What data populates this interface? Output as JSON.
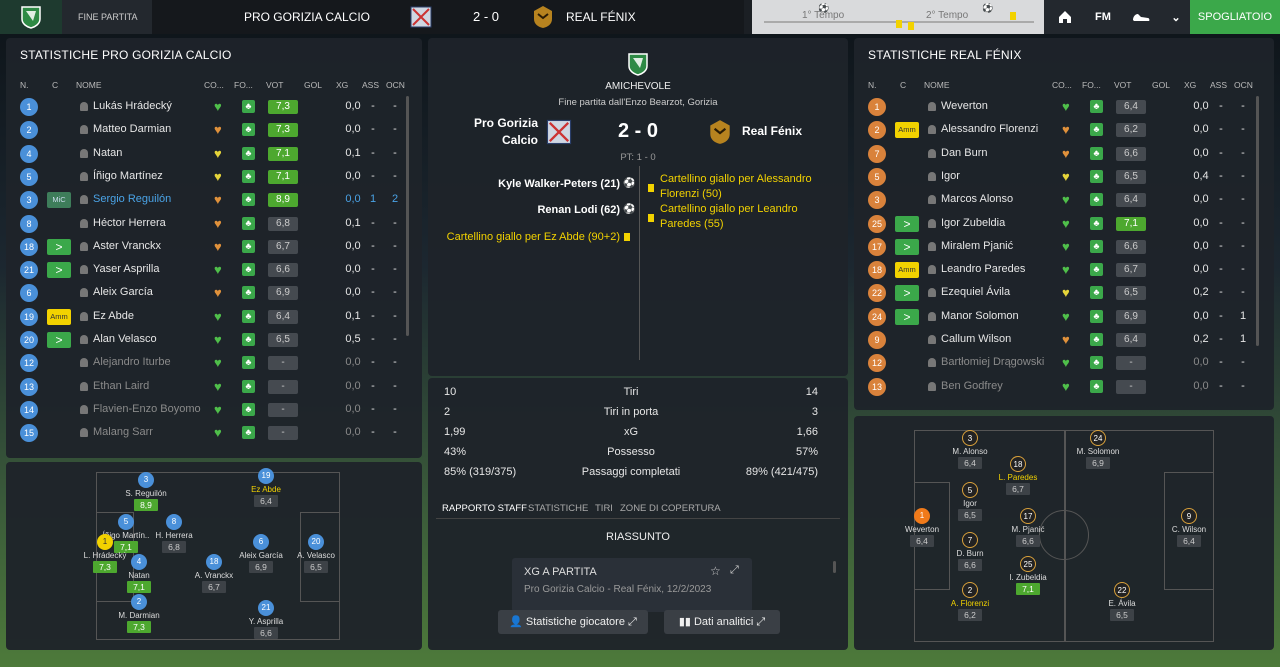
{
  "topbar": {
    "status": "FINE PARTITA",
    "home": "PRO GORIZIA CALCIO",
    "score": "2 - 0",
    "away": "REAL FÉNIX",
    "t1": "1° Tempo",
    "t2": "2° Tempo",
    "fm": "FM",
    "spogliatoio": "SPOGLIATOIO"
  },
  "home_panel": {
    "title": "STATISTICHE PRO GORIZIA CALCIO",
    "headers": {
      "n": "N.",
      "c": "C",
      "nome": "NOME",
      "con": "CO...",
      "form": "FO...",
      "vot": "VOT",
      "gol": "GOL",
      "xg": "XG",
      "ass": "ASS",
      "ocn": "OCN"
    },
    "players": [
      {
        "n": "1",
        "c": "",
        "name": "Lukás Hrádecký",
        "heart": "g",
        "vot": "7,3",
        "vg": true,
        "xg": "0,0",
        "ass": "-",
        "ocn": "-"
      },
      {
        "n": "2",
        "c": "",
        "name": "Matteo Darmian",
        "heart": "o",
        "vot": "7,3",
        "vg": true,
        "xg": "0,0",
        "ass": "-",
        "ocn": "-"
      },
      {
        "n": "4",
        "c": "",
        "name": "Natan",
        "heart": "y",
        "vot": "7,1",
        "vg": true,
        "xg": "0,1",
        "ass": "-",
        "ocn": "-"
      },
      {
        "n": "5",
        "c": "",
        "name": "Íñigo Martínez",
        "heart": "y",
        "vot": "7,1",
        "vg": true,
        "xg": "0,0",
        "ass": "-",
        "ocn": "-"
      },
      {
        "n": "3",
        "c": "MiC",
        "name": "Sergio Reguilón",
        "heart": "o",
        "vot": "8,9",
        "vg": true,
        "xg": "0,0",
        "ass": "1",
        "ocn": "2",
        "hl": true
      },
      {
        "n": "8",
        "c": "",
        "name": "Héctor Herrera",
        "heart": "o",
        "vot": "6,8",
        "vg": false,
        "xg": "0,1",
        "ass": "-",
        "ocn": "-"
      },
      {
        "n": "18",
        "c": "arrow",
        "name": "Aster Vranckx",
        "heart": "o",
        "vot": "6,7",
        "vg": false,
        "xg": "0,0",
        "ass": "-",
        "ocn": "-"
      },
      {
        "n": "21",
        "c": "arrow",
        "name": "Yaser Asprilla",
        "heart": "g",
        "vot": "6,6",
        "vg": false,
        "xg": "0,0",
        "ass": "-",
        "ocn": "-"
      },
      {
        "n": "6",
        "c": "",
        "name": "Aleix García",
        "heart": "o",
        "vot": "6,9",
        "vg": false,
        "xg": "0,0",
        "ass": "-",
        "ocn": "-"
      },
      {
        "n": "19",
        "c": "Amm",
        "name": "Ez Abde",
        "heart": "g",
        "vot": "6,4",
        "vg": false,
        "xg": "0,1",
        "ass": "-",
        "ocn": "-"
      },
      {
        "n": "20",
        "c": "arrow",
        "name": "Alan Velasco",
        "heart": "g",
        "vot": "6,5",
        "vg": false,
        "xg": "0,5",
        "ass": "-",
        "ocn": "-"
      },
      {
        "n": "12",
        "c": "",
        "name": "Alejandro Iturbe",
        "heart": "g",
        "vot": "-",
        "vg": false,
        "xg": "0,0",
        "ass": "-",
        "ocn": "-",
        "dim": true
      },
      {
        "n": "13",
        "c": "",
        "name": "Ethan Laird",
        "heart": "g",
        "vot": "-",
        "vg": false,
        "xg": "0,0",
        "ass": "-",
        "ocn": "-",
        "dim": true
      },
      {
        "n": "14",
        "c": "",
        "name": "Flavien-Enzo Boyomo",
        "heart": "g",
        "vot": "-",
        "vg": false,
        "xg": "0,0",
        "ass": "-",
        "ocn": "-",
        "dim": true
      },
      {
        "n": "15",
        "c": "",
        "name": "Malang Sarr",
        "heart": "g",
        "vot": "-",
        "vg": false,
        "xg": "0,0",
        "ass": "-",
        "ocn": "-",
        "dim": true
      }
    ]
  },
  "away_panel": {
    "title": "STATISTICHE REAL FÉNIX",
    "players": [
      {
        "n": "1",
        "c": "",
        "name": "Weverton",
        "heart": "g",
        "vot": "6,4",
        "vg": false,
        "xg": "0,0",
        "ass": "-",
        "ocn": "-"
      },
      {
        "n": "2",
        "c": "Amm",
        "name": "Alessandro Florenzi",
        "heart": "o",
        "vot": "6,2",
        "vg": false,
        "xg": "0,0",
        "ass": "-",
        "ocn": "-"
      },
      {
        "n": "7",
        "c": "",
        "name": "Dan Burn",
        "heart": "o",
        "vot": "6,6",
        "vg": false,
        "xg": "0,0",
        "ass": "-",
        "ocn": "-"
      },
      {
        "n": "5",
        "c": "",
        "name": "Igor",
        "heart": "y",
        "vot": "6,5",
        "vg": false,
        "xg": "0,4",
        "ass": "-",
        "ocn": "-"
      },
      {
        "n": "3",
        "c": "",
        "name": "Marcos Alonso",
        "heart": "g",
        "vot": "6,4",
        "vg": false,
        "xg": "0,0",
        "ass": "-",
        "ocn": "-"
      },
      {
        "n": "25",
        "c": "arrow",
        "name": "Igor Zubeldia",
        "heart": "g",
        "vot": "7,1",
        "vg": true,
        "xg": "0,0",
        "ass": "-",
        "ocn": "-"
      },
      {
        "n": "17",
        "c": "arrow",
        "name": "Miralem Pjanić",
        "heart": "g",
        "vot": "6,6",
        "vg": false,
        "xg": "0,0",
        "ass": "-",
        "ocn": "-"
      },
      {
        "n": "18",
        "c": "Amm",
        "name": "Leandro Paredes",
        "heart": "g",
        "vot": "6,7",
        "vg": false,
        "xg": "0,0",
        "ass": "-",
        "ocn": "-"
      },
      {
        "n": "22",
        "c": "arrow",
        "name": "Ezequiel Ávila",
        "heart": "y",
        "vot": "6,5",
        "vg": false,
        "xg": "0,2",
        "ass": "-",
        "ocn": "-"
      },
      {
        "n": "24",
        "c": "arrow",
        "name": "Manor Solomon",
        "heart": "g",
        "vot": "6,9",
        "vg": false,
        "xg": "0,0",
        "ass": "-",
        "ocn": "1"
      },
      {
        "n": "9",
        "c": "",
        "name": "Callum Wilson",
        "heart": "o",
        "vot": "6,4",
        "vg": false,
        "xg": "0,2",
        "ass": "-",
        "ocn": "1"
      },
      {
        "n": "12",
        "c": "",
        "name": "Bartłomiej Drągowski",
        "heart": "g",
        "vot": "-",
        "vg": false,
        "xg": "0,0",
        "ass": "-",
        "ocn": "-",
        "dim": true
      },
      {
        "n": "13",
        "c": "",
        "name": "Ben Godfrey",
        "heart": "g",
        "vot": "-",
        "vg": false,
        "xg": "0,0",
        "ass": "-",
        "ocn": "-",
        "dim": true
      }
    ]
  },
  "home_pitch": [
    {
      "n": "3",
      "name": "S. Reguilón",
      "r": "8,9",
      "g": true
    },
    {
      "n": "19",
      "name": "Ez Abde",
      "r": "6,4",
      "y": true
    },
    {
      "n": "5",
      "name": "Íñigo Martín..",
      "r": "7,1",
      "g": true
    },
    {
      "n": "8",
      "name": "H. Herrera",
      "r": "6,8"
    },
    {
      "n": "1",
      "name": "L. Hrádecký",
      "r": "7,3",
      "g": true,
      "k": true
    },
    {
      "n": "4",
      "name": "Natan",
      "r": "7,1",
      "g": true
    },
    {
      "n": "18",
      "name": "A. Vranckx",
      "r": "6,7"
    },
    {
      "n": "6",
      "name": "Aleix García",
      "r": "6,9"
    },
    {
      "n": "20",
      "name": "A. Velasco",
      "r": "6,5"
    },
    {
      "n": "2",
      "name": "M. Darmian",
      "r": "7,3",
      "g": true
    },
    {
      "n": "21",
      "name": "Y. Asprilla",
      "r": "6,6"
    }
  ],
  "away_pitch": [
    {
      "n": "3",
      "name": "M. Alonso",
      "r": "6,4"
    },
    {
      "n": "24",
      "name": "M. Solomon",
      "r": "6,9"
    },
    {
      "n": "18",
      "name": "L. Paredes",
      "r": "6,7",
      "y": true
    },
    {
      "n": "5",
      "name": "Igor",
      "r": "6,5"
    },
    {
      "n": "1",
      "name": "Weverton",
      "r": "6,4",
      "w": true
    },
    {
      "n": "17",
      "name": "M. Pjanić",
      "r": "6,6"
    },
    {
      "n": "9",
      "name": "C. Wilson",
      "r": "6,4"
    },
    {
      "n": "7",
      "name": "D. Burn",
      "r": "6,6"
    },
    {
      "n": "25",
      "name": "I. Zubeldia",
      "r": "7,1",
      "g": true
    },
    {
      "n": "2",
      "name": "A. Florenzi",
      "r": "6,2",
      "y": true
    },
    {
      "n": "22",
      "name": "E. Ávila",
      "r": "6,5"
    }
  ],
  "center": {
    "competition": "AMICHEVOLE",
    "subtitle": "Fine partita dall'Enzo Bearzot, Gorizia",
    "home": "Pro Gorizia Calcio",
    "away": "Real Fénix",
    "score": "2 - 0",
    "ht": "PT: 1 - 0",
    "events_home": [
      "Kyle Walker-Peters (21)",
      "Renan Lodi (62)",
      "Cartellino giallo per Ez Abde (90+2)"
    ],
    "events_away": [
      "Cartellino giallo per Alessandro Florenzi (50)",
      "Cartellino giallo per Leandro Paredes (55)"
    ],
    "stats": [
      {
        "h": "10",
        "label": "Tiri",
        "a": "14"
      },
      {
        "h": "2",
        "label": "Tiri in porta",
        "a": "3"
      },
      {
        "h": "1,99",
        "label": "xG",
        "a": "1,66"
      },
      {
        "h": "43%",
        "label": "Possesso",
        "a": "57%"
      },
      {
        "h": "85% (319/375)",
        "label": "Passaggi completati",
        "a": "89% (421/475)"
      }
    ],
    "tabs": [
      "RAPPORTO STAFF",
      "STATISTICHE",
      "TIRI",
      "ZONE DI COPERTURA"
    ],
    "summary": "RIASSUNTO",
    "card_title": "XG A PARTITA",
    "card_sub": "Pro Gorizia Calcio - Real Fénix, 12/2/2023",
    "btn1": "Statistiche giocatore",
    "btn2": "Dati analitici"
  },
  "colors": {
    "green": "#3ba84a",
    "yellow": "#f2d200",
    "blue": "#4a90d9",
    "orange": "#d9823b"
  }
}
